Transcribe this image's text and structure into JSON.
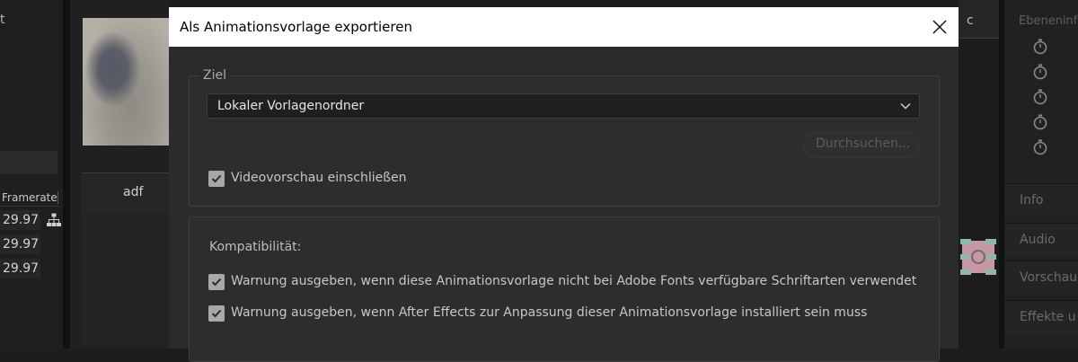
{
  "background": {
    "left_fragment": "t",
    "framerate_header": "Framerate",
    "framerate_values": [
      "29.97",
      "29.97",
      "29.97"
    ],
    "tab_label": "adf",
    "right_mid_fragment": "c",
    "right_panel": {
      "title": "Ebeneninf",
      "sections": [
        "Info",
        "Audio",
        "Vorschau",
        "Effekte u"
      ]
    }
  },
  "dialog": {
    "title": "Als Animationsvorlage exportieren",
    "ziel": {
      "legend": "Ziel",
      "select_value": "Lokaler Vorlagenordner",
      "browse_label": "Durchsuchen...",
      "video_preview_label": "Videovorschau einschließen",
      "video_preview_checked": true
    },
    "compatibility": {
      "heading": "Kompatibilität:",
      "warn_fonts_label": "Warnung ausgeben, wenn diese Animationsvorlage nicht bei Adobe Fonts verfügbare Schriftarten verwendet",
      "warn_fonts_checked": true,
      "warn_ae_label": "Warnung ausgeben, wenn After Effects zur Anpassung dieser Animationsvorlage installiert sein muss",
      "warn_ae_checked": true
    }
  },
  "icons": [
    "close-icon",
    "chevron-down-icon",
    "check-icon",
    "hierarchy-icon",
    "stopwatch-icon"
  ]
}
